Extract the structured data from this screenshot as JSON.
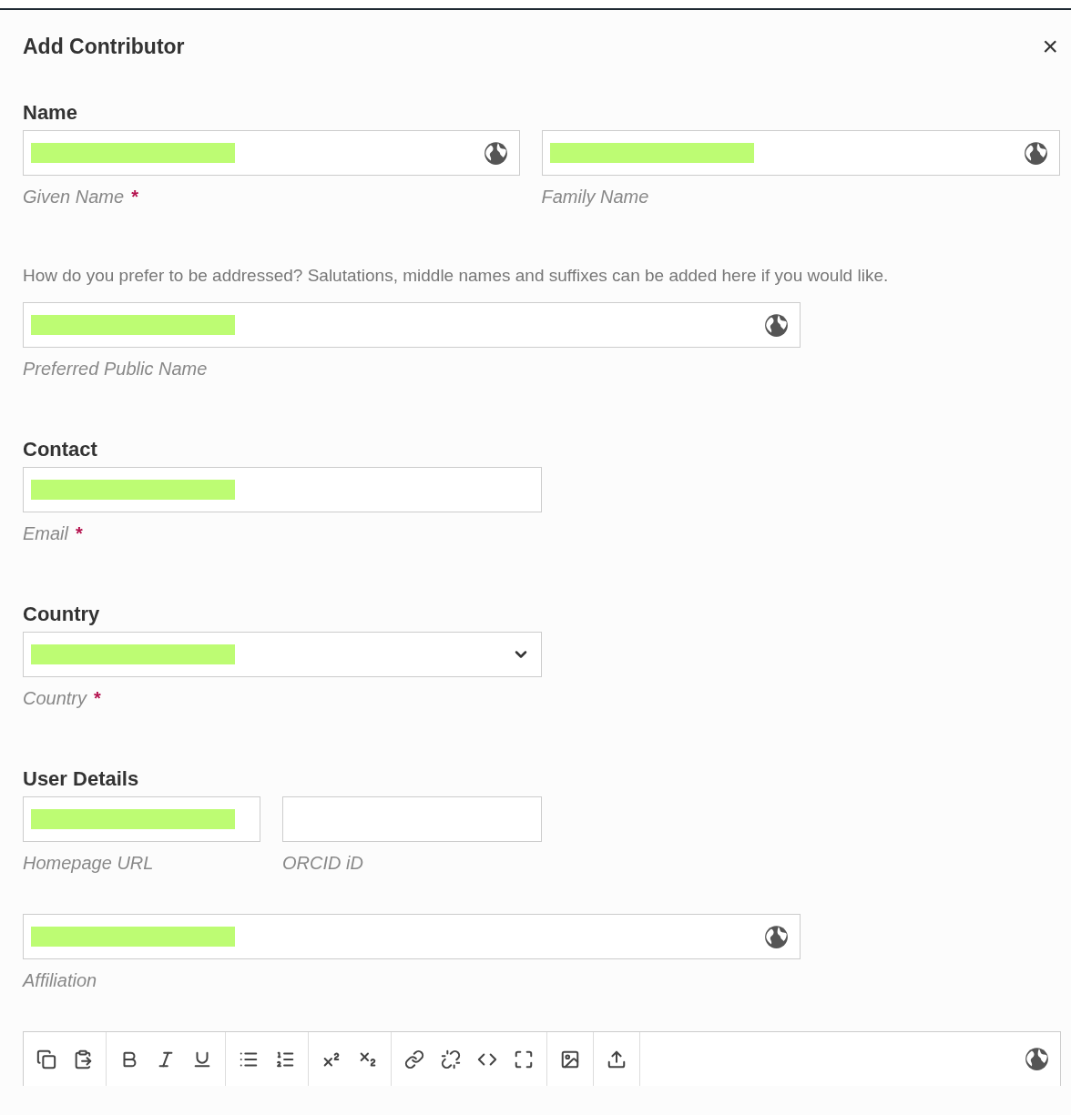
{
  "dialog": {
    "title": "Add Contributor",
    "close": "×"
  },
  "name_section": {
    "heading": "Name",
    "given_name": {
      "label": "Given Name",
      "required_mark": "*",
      "redacted": true,
      "multilingual": true
    },
    "family_name": {
      "label": "Family Name",
      "redacted": true,
      "multilingual": true
    },
    "note": "How do you prefer to be addressed? Salutations, middle names and suffixes can be added here if you would like.",
    "preferred_name": {
      "label": "Preferred Public Name",
      "redacted": true,
      "multilingual": true
    }
  },
  "contact_section": {
    "heading": "Contact",
    "email": {
      "label": "Email",
      "required_mark": "*",
      "redacted": true,
      "multilingual": false
    }
  },
  "country_section": {
    "heading": "Country",
    "country": {
      "label": "Country",
      "required_mark": "*",
      "redacted": true,
      "multilingual": false
    }
  },
  "user_details_section": {
    "heading": "User Details",
    "homepage_url": {
      "label": "Homepage URL",
      "redacted": true,
      "multilingual": false
    },
    "orcid": {
      "label": "ORCID iD",
      "redacted": false,
      "multilingual": false
    },
    "affiliation": {
      "label": "Affiliation",
      "redacted": true,
      "multilingual": true
    }
  },
  "editor": {
    "multilingual": true
  }
}
